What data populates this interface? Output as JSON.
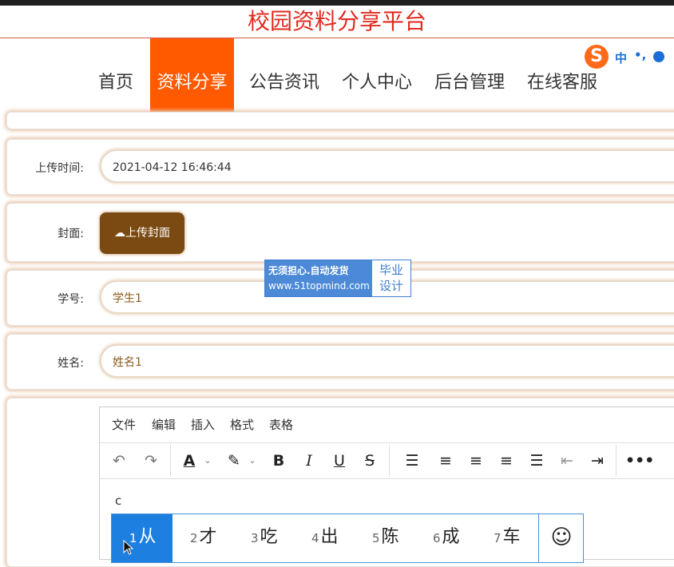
{
  "site": {
    "title": "校园资料分享平台"
  },
  "nav": {
    "items": [
      {
        "label": "首页",
        "active": false
      },
      {
        "label": "资料分享",
        "active": true
      },
      {
        "label": "公告资讯",
        "active": false
      },
      {
        "label": "个人中心",
        "active": false
      },
      {
        "label": "后台管理",
        "active": false
      },
      {
        "label": "在线客服",
        "active": false
      }
    ]
  },
  "ime_bar": {
    "logo": "S",
    "mode": "中",
    "punct": "•,"
  },
  "form": {
    "upload_time": {
      "label": "上传时间:",
      "value": "2021-04-12 16:46:44"
    },
    "cover": {
      "label": "封面:",
      "button": "上传封面"
    },
    "student_id": {
      "label": "学号:",
      "value": "学生1"
    },
    "name": {
      "label": "姓名:",
      "value": "姓名1"
    }
  },
  "watermark": {
    "line1": "无须担心.自动发货",
    "line2": "www.51topmind.com",
    "right1": "毕业",
    "right2": "设计"
  },
  "editor": {
    "menus": [
      "文件",
      "编辑",
      "插入",
      "格式",
      "表格"
    ],
    "content": "c"
  },
  "ime_candidates": {
    "items": [
      {
        "num": "1",
        "text": "从"
      },
      {
        "num": "2",
        "text": "才"
      },
      {
        "num": "3",
        "text": "吃"
      },
      {
        "num": "4",
        "text": "出"
      },
      {
        "num": "5",
        "text": "陈"
      },
      {
        "num": "6",
        "text": "成"
      },
      {
        "num": "7",
        "text": "车"
      }
    ],
    "emoji": "☺"
  },
  "colors": {
    "accent": "#ff5a00",
    "title": "#e02a1f",
    "upload_button": "#7a4a12",
    "ime_selected": "#1d7fe0"
  }
}
